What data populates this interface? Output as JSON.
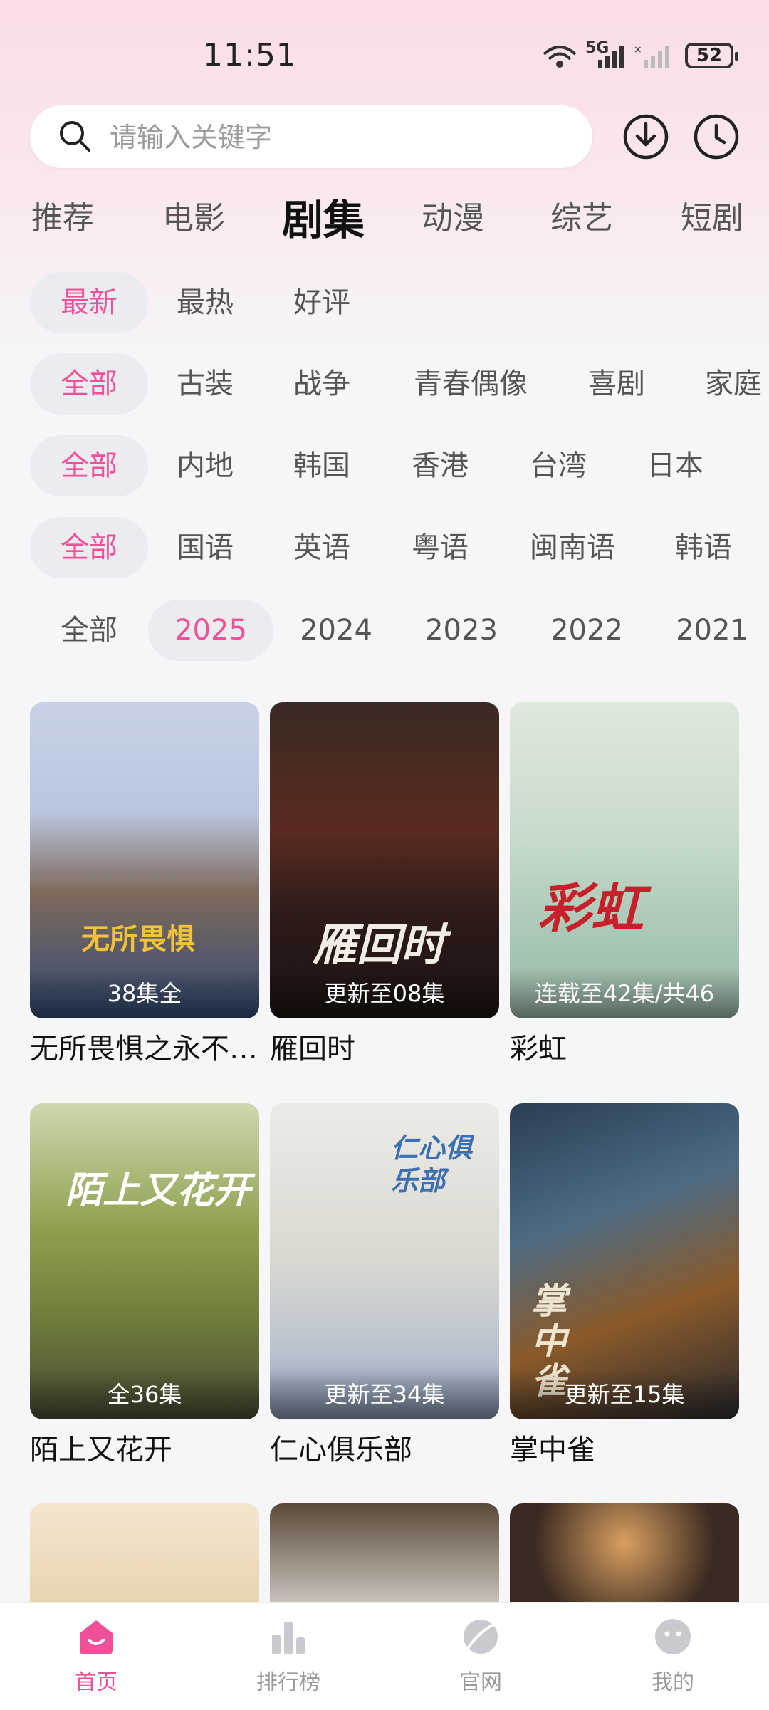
{
  "status_bar": {
    "time": "11:51",
    "battery": "52",
    "network": "5G"
  },
  "search": {
    "placeholder": "请输入关键字"
  },
  "categories": [
    "推荐",
    "电影",
    "剧集",
    "动漫",
    "综艺",
    "短剧"
  ],
  "active_category": "剧集",
  "filters": {
    "sort": [
      "最新",
      "最热",
      "好评"
    ],
    "genre": [
      "全部",
      "古装",
      "战争",
      "青春偶像",
      "喜剧",
      "家庭"
    ],
    "region": [
      "全部",
      "内地",
      "韩国",
      "香港",
      "台湾",
      "日本"
    ],
    "language": [
      "全部",
      "国语",
      "英语",
      "粤语",
      "闽南语",
      "韩语"
    ],
    "year": [
      "全部",
      "2025",
      "2024",
      "2023",
      "2022",
      "2021"
    ]
  },
  "shows": [
    {
      "title": "无所畏惧之永不放弃",
      "episodes": "38集全",
      "poster_text": "无所畏惧"
    },
    {
      "title": "雁回时",
      "episodes": "更新至08集",
      "poster_text": "雁回时"
    },
    {
      "title": "彩虹",
      "episodes": "连载至42集/共46",
      "poster_text": "彩虹"
    },
    {
      "title": "陌上又花开",
      "episodes": "全36集",
      "poster_text": "陌上又花开"
    },
    {
      "title": "仁心俱乐部",
      "episodes": "更新至34集",
      "poster_text": "仁心俱乐部"
    },
    {
      "title": "掌中雀",
      "episodes": "更新至15集",
      "poster_text": "掌中雀"
    }
  ],
  "tabs": [
    "首页",
    "排行榜",
    "官网",
    "我的"
  ],
  "colors": {
    "accent": "#f0509a",
    "chip_bg": "#ecebef"
  }
}
